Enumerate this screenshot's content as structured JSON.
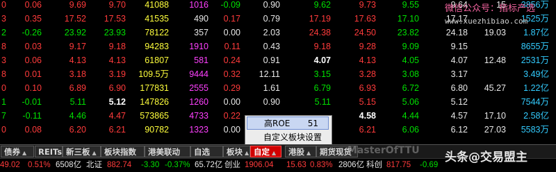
{
  "rows": [
    [
      [
        "0",
        "r"
      ],
      [
        "0.06",
        "r"
      ],
      [
        "9.69",
        "r"
      ],
      [
        "9.70",
        "r"
      ],
      [
        "41088",
        "y"
      ],
      [
        "1016",
        "m"
      ],
      [
        "-0.09",
        "g"
      ],
      [
        "0.90",
        "w"
      ],
      [
        "9.62",
        "g"
      ],
      [
        "9.73",
        "r"
      ],
      [
        "9.55",
        "g"
      ],
      [
        "9.64",
        "w"
      ],
      [
        "15",
        "w"
      ],
      [
        "3856万",
        "c"
      ]
    ],
    [
      [
        "3",
        "r"
      ],
      [
        "0.35",
        "r"
      ],
      [
        "17.52",
        "r"
      ],
      [
        "17.53",
        "r"
      ],
      [
        "41535",
        "y"
      ],
      [
        "490",
        "w"
      ],
      [
        "0.17",
        "r"
      ],
      [
        "0.79",
        "w"
      ],
      [
        "17.19",
        "r"
      ],
      [
        "17.63",
        "r"
      ],
      [
        "17.10",
        "g"
      ],
      [
        "17.17",
        "w"
      ],
      [
        "",
        "w"
      ],
      [
        "1525万",
        "c"
      ]
    ],
    [
      [
        "2",
        "g"
      ],
      [
        "-0.26",
        "g"
      ],
      [
        "23.92",
        "g"
      ],
      [
        "23.93",
        "g"
      ],
      [
        "78122",
        "y"
      ],
      [
        "357",
        "w"
      ],
      [
        "0.00",
        "w"
      ],
      [
        "2.03",
        "w"
      ],
      [
        "24.38",
        "r"
      ],
      [
        "24.50",
        "r"
      ],
      [
        "23.82",
        "g"
      ],
      [
        "24.18",
        "w"
      ],
      [
        "19.03",
        "w"
      ],
      [
        "1.87亿",
        "c"
      ]
    ],
    [
      [
        "8",
        "r"
      ],
      [
        "0.03",
        "r"
      ],
      [
        "9.17",
        "r"
      ],
      [
        "9.18",
        "r"
      ],
      [
        "94283",
        "y"
      ],
      [
        "1910",
        "m"
      ],
      [
        "0.11",
        "r"
      ],
      [
        "0.43",
        "w"
      ],
      [
        "9.18",
        "r"
      ],
      [
        "9.28",
        "r"
      ],
      [
        "9.09",
        "g"
      ],
      [
        "9.15",
        "w"
      ],
      [
        "",
        "w"
      ],
      [
        "8655万",
        "c"
      ]
    ],
    [
      [
        "3",
        "r"
      ],
      [
        "0.06",
        "r"
      ],
      [
        "4.13",
        "r"
      ],
      [
        "4.13",
        "r"
      ],
      [
        "61807",
        "y"
      ],
      [
        "581",
        "m"
      ],
      [
        "0.24",
        "r"
      ],
      [
        "0.91",
        "w"
      ],
      [
        "4.07",
        "bw"
      ],
      [
        "4.13",
        "r"
      ],
      [
        "4.05",
        "g"
      ],
      [
        "4.07",
        "w"
      ],
      [
        "12.48",
        "w"
      ],
      [
        "2531万",
        "c"
      ]
    ],
    [
      [
        "8",
        "r"
      ],
      [
        "0.01",
        "r"
      ],
      [
        "3.18",
        "r"
      ],
      [
        "3.19",
        "r"
      ],
      [
        "109.5万",
        "y"
      ],
      [
        "9444",
        "m"
      ],
      [
        "0.32",
        "r"
      ],
      [
        "12.11",
        "w"
      ],
      [
        "3.15",
        "g"
      ],
      [
        "3.28",
        "r"
      ],
      [
        "3.08",
        "g"
      ],
      [
        "3.17",
        "w"
      ],
      [
        "",
        "w"
      ],
      [
        "3.49亿",
        "c"
      ]
    ],
    [
      [
        "0",
        "r"
      ],
      [
        "0.10",
        "r"
      ],
      [
        "6.89",
        "r"
      ],
      [
        "6.90",
        "r"
      ],
      [
        "177831",
        "y"
      ],
      [
        "2555",
        "m"
      ],
      [
        "0.29",
        "r"
      ],
      [
        "1.61",
        "w"
      ],
      [
        "6.79",
        "g"
      ],
      [
        "6.93",
        "r"
      ],
      [
        "6.72",
        "g"
      ],
      [
        "6.80",
        "w"
      ],
      [
        "45.27",
        "w"
      ],
      [
        "1.22亿",
        "c"
      ]
    ],
    [
      [
        "1",
        "g"
      ],
      [
        "-0.01",
        "g"
      ],
      [
        "5.11",
        "g"
      ],
      [
        "5.12",
        "bw"
      ],
      [
        "147826",
        "y"
      ],
      [
        "1260",
        "m"
      ],
      [
        "0.00",
        "w"
      ],
      [
        "0.90",
        "w"
      ],
      [
        "5.11",
        "g"
      ],
      [
        "5.15",
        "r"
      ],
      [
        "5.06",
        "g"
      ],
      [
        "5.12",
        "w"
      ],
      [
        "",
        "w"
      ],
      [
        "7544万",
        "c"
      ]
    ],
    [
      [
        "7",
        "g"
      ],
      [
        "-0.11",
        "g"
      ],
      [
        "4.46",
        "g"
      ],
      [
        "4.47",
        "r"
      ],
      [
        "573865",
        "y"
      ],
      [
        "4733",
        "m"
      ],
      [
        "0.22",
        "r"
      ],
      [
        "",
        "w"
      ],
      [
        "",
        "w"
      ],
      [
        "4.58",
        "bw"
      ],
      [
        "4.44",
        "g"
      ],
      [
        "4.57",
        "w"
      ],
      [
        "17.10",
        "w"
      ],
      [
        "2.58亿",
        "c"
      ]
    ],
    [
      [
        "0",
        "r"
      ],
      [
        "0.08",
        "r"
      ],
      [
        "6.20",
        "r"
      ],
      [
        "6.21",
        "r"
      ],
      [
        "90782",
        "y"
      ],
      [
        "1323",
        "m"
      ],
      [
        "0.00",
        "w"
      ],
      [
        "",
        "w"
      ],
      [
        "",
        "w"
      ],
      [
        "6.21",
        "r"
      ],
      [
        "6.06",
        "g"
      ],
      [
        "6.12",
        "w"
      ],
      [
        "27.03",
        "w"
      ],
      [
        "5583万",
        "c"
      ]
    ]
  ],
  "watermark": {
    "line1": "微信公众号：指标产选",
    "line2": "www.xuezhibiao.com"
  },
  "context_menu": {
    "items": [
      {
        "label": "高ROE",
        "count": "51",
        "selected": true
      },
      {
        "label": "自定义板块设置",
        "count": "",
        "selected": false
      }
    ]
  },
  "tabs": [
    {
      "label": "债券",
      "has_arrow": true,
      "active": false
    },
    {
      "label": "REITs",
      "has_arrow": true,
      "active": false
    },
    {
      "label": "新三板",
      "has_arrow": true,
      "active": false
    },
    {
      "label": "板块指数",
      "has_arrow": false,
      "active": false
    },
    {
      "label": "港美联动",
      "has_arrow": false,
      "active": false
    },
    {
      "label": "自选",
      "has_arrow": false,
      "active": false
    },
    {
      "label": "板块",
      "has_arrow": true,
      "active": false
    },
    {
      "label": "自定",
      "has_arrow": true,
      "active": true
    },
    {
      "label": "港股",
      "has_arrow": true,
      "active": false
    },
    {
      "label": "期货现货",
      "has_arrow": false,
      "active": false
    }
  ],
  "status": [
    [
      "49.02",
      "r"
    ],
    [
      "0.51%",
      "r"
    ],
    [
      "6508亿",
      "w"
    ],
    [
      "北证",
      "w"
    ],
    [
      "882.74",
      "r"
    ],
    [
      "-3.30",
      "g"
    ],
    [
      "-0.37%",
      "g"
    ],
    [
      "65.72亿",
      "w"
    ],
    [
      "创业",
      "w"
    ],
    [
      "1906.04",
      "r"
    ],
    [
      "15.63",
      "r"
    ],
    [
      "0.83%",
      "r"
    ],
    [
      "2806亿",
      "w"
    ],
    [
      "科创",
      "w"
    ],
    [
      "817.75",
      "r"
    ],
    [
      "-0.69",
      "g"
    ]
  ],
  "signature": "头条@交易盟主",
  "signature2": "MasterOfTTU"
}
